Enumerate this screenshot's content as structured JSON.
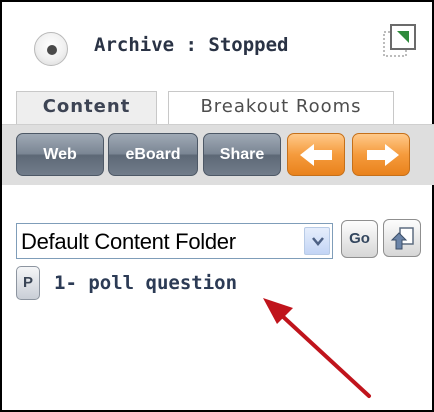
{
  "header": {
    "status_text": "Archive : Stopped",
    "status_icon": "radio-dot-icon",
    "popout_icon": "popout-window-icon"
  },
  "tabs": [
    {
      "label": "Content",
      "active": true
    },
    {
      "label": "Breakout Rooms",
      "active": false
    }
  ],
  "toolbar": {
    "web_label": "Web",
    "eboard_label": "eBoard",
    "share_label": "Share",
    "back_icon": "arrow-left-icon",
    "forward_icon": "arrow-right-icon"
  },
  "folder": {
    "selected": "Default Content Folder",
    "go_label": "Go",
    "upload_icon": "upload-icon"
  },
  "content_items": [
    {
      "badge": "P",
      "label": "1- poll question"
    }
  ],
  "annotation": {
    "icon": "red-pointer-arrow"
  },
  "colors": {
    "accent_orange": "#f59b3d",
    "toolbar_grey": "#7b8694",
    "annotation_red": "#c0141c",
    "text_navy": "#2c3b55"
  }
}
